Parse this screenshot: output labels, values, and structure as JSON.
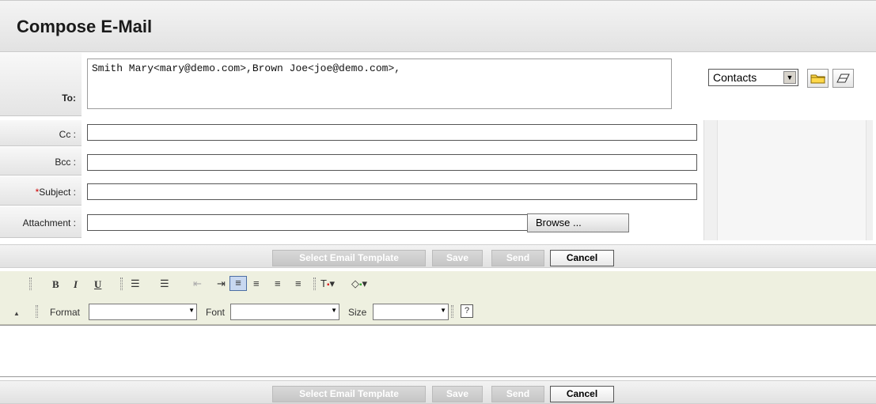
{
  "title": "Compose E-Mail",
  "fields": {
    "to_label": "To:",
    "to_value": "Smith Mary<mary@demo.com>,Brown Joe<joe@demo.com>,",
    "cc_label": "Cc :",
    "bcc_label": "Bcc :",
    "subject_required_mark": "*",
    "subject_label": "Subject :",
    "attachment_label": "Attachment :",
    "browse_label": "Browse ..."
  },
  "contacts": {
    "selected": "Contacts"
  },
  "icons": {
    "open_folder": "folder-icon",
    "eraser": "eraser-icon"
  },
  "actions": {
    "select_template": "Select Email Template",
    "save": "Save",
    "send": "Send",
    "cancel": "Cancel"
  },
  "editor_toolbar": {
    "bold": "B",
    "italic": "I",
    "underline": "U",
    "format_label": "Format",
    "font_label": "Font",
    "size_label": "Size",
    "help": "?"
  },
  "colors": {
    "required": "#cc0000",
    "toolbar_bg": "#eef0e0"
  }
}
